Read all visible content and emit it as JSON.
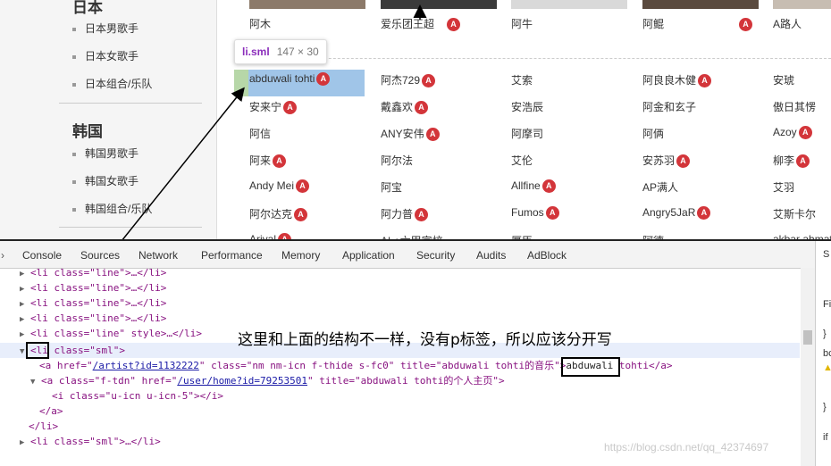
{
  "sidebar": {
    "sections": [
      {
        "title": "日本",
        "items": [
          "日本男歌手",
          "日本女歌手",
          "日本组合/乐队"
        ]
      },
      {
        "title": "韩国",
        "items": [
          "韩国男歌手",
          "韩国女歌手",
          "韩国组合/乐队"
        ]
      }
    ]
  },
  "top_row": [
    "阿木",
    "爱乐团王超",
    "阿牛",
    "阿鲲",
    "A路人"
  ],
  "tooltip": {
    "tag": "li.sml",
    "dims": "147 × 30"
  },
  "artist_grid": [
    [
      "abduwali tohti",
      "阿杰729",
      "艾索",
      "阿良良木健",
      "安琥"
    ],
    [
      "安来宁",
      "戴鑫欢",
      "安浩辰",
      "阿金和玄子",
      "傲日其愣"
    ],
    [
      "阿信",
      "ANY安伟",
      "阿摩司",
      "阿俩",
      "Azoy"
    ],
    [
      "阿来",
      "阿尔法",
      "艾伦",
      "安苏羽",
      "柳李"
    ],
    [
      "Andy Mei",
      "阿宝",
      "Allfine",
      "AP满人",
      "艾羽"
    ],
    [
      "阿尔达克",
      "阿力普",
      "Fumos",
      "Angry5JaR",
      "艾斯卡尔"
    ],
    [
      "Ariyal",
      "AL+六甲宫校",
      "厚臣",
      "阿德",
      "akbar ahmat"
    ]
  ],
  "devtools": {
    "tabs": [
      "Console",
      "Sources",
      "Network",
      "Performance",
      "Memory",
      "Application",
      "Security",
      "Audits",
      "AdBlock"
    ],
    "note": "这里和上面的结构不一样，没有p标签，所以应该分开写",
    "code": {
      "li_line": "<li class=\"line\">…</li>",
      "li_line_style": "<li class=\"line\" style>…</li>",
      "li_sml_open": "<li class=\"sml\">",
      "a1_pre": "<a href=\"",
      "a1_href": "/artist?id=1132222",
      "a1_mid": "\" class=\"nm nm-icn f-thide s-fc0\" title=\"abduwali tohti的音乐\">",
      "a1_boxed": "abduwali",
      "a1_post": " tohti</a>",
      "a2_pre": "<a class=\"f-tdn\" href=\"",
      "a2_href": "/user/home?id=79253501",
      "a2_post": "\" title=\"abduwali tohti的个人主页\">",
      "i_line": "<i class=\"u-icn u-icn-5\"></i>",
      "a_close": "</a>",
      "li_close": "</li>",
      "li_sml_collapsed": "<li class=\"sml\">…</li>"
    },
    "right_panel": [
      "S",
      "Fi",
      "}",
      "bc",
      "}",
      "if"
    ]
  },
  "watermark": "https://blog.csdn.net/qq_42374697"
}
